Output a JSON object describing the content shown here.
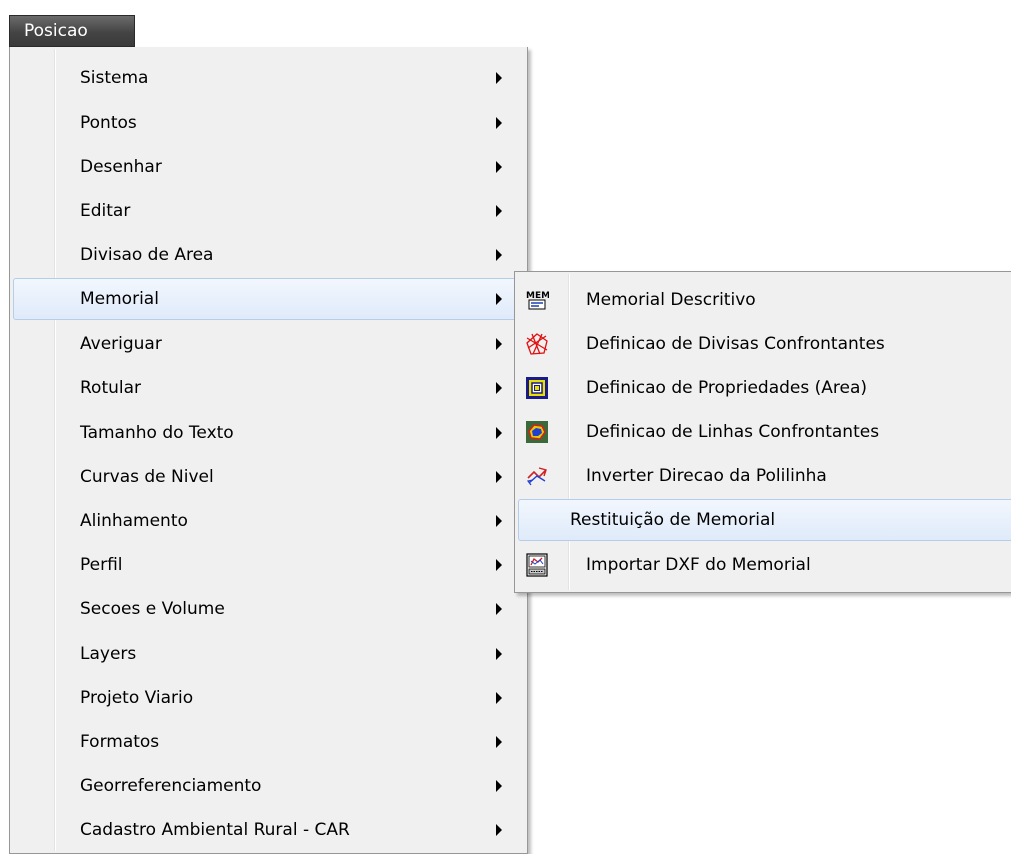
{
  "menubar": {
    "title": "Posicao"
  },
  "menu": {
    "items": [
      {
        "label": "Sistema"
      },
      {
        "label": "Pontos"
      },
      {
        "label": "Desenhar"
      },
      {
        "label": "Editar"
      },
      {
        "label": "Divisao de Area"
      },
      {
        "label": "Memorial"
      },
      {
        "label": "Averiguar"
      },
      {
        "label": "Rotular"
      },
      {
        "label": "Tamanho do Texto"
      },
      {
        "label": "Curvas de Nivel"
      },
      {
        "label": "Alinhamento"
      },
      {
        "label": "Perfil"
      },
      {
        "label": "Secoes e Volume"
      },
      {
        "label": "Layers"
      },
      {
        "label": "Projeto Viario"
      },
      {
        "label": "Formatos"
      },
      {
        "label": "Georreferenciamento"
      },
      {
        "label": "Cadastro Ambiental Rural - CAR"
      }
    ],
    "highlighted_index": 5
  },
  "submenu": {
    "items": [
      {
        "label": "Memorial Descritivo",
        "icon": "mem-icon"
      },
      {
        "label": "Definicao de Divisas Confrontantes",
        "icon": "red-mesh-icon"
      },
      {
        "label": "Definicao de Propriedades (Area)",
        "icon": "property-area-icon"
      },
      {
        "label": "Definicao de Linhas Confrontantes",
        "icon": "confrontantes-lines-icon"
      },
      {
        "label": "Inverter Direcao da Polilinha",
        "icon": "invert-polyline-icon"
      },
      {
        "label": "Restituição de Memorial",
        "icon": ""
      },
      {
        "label": "Importar DXF do Memorial",
        "icon": "import-dxf-icon"
      }
    ],
    "highlighted_index": 5
  },
  "colors": {
    "menu_background": "#f0f0f0",
    "highlight_background": "#dfeafa",
    "highlight_border": "#b4cde9",
    "menubar_background": "#444444",
    "menubar_text": "#ffffff"
  }
}
